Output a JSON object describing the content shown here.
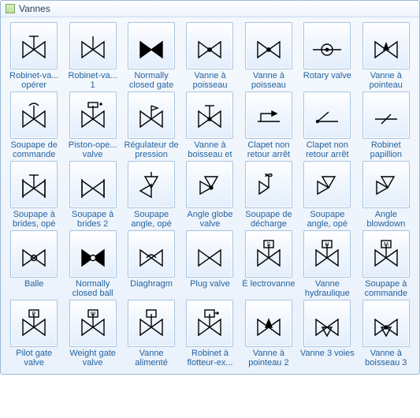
{
  "panel": {
    "title": "Vannes"
  },
  "items": [
    {
      "label": "Robinet-va... opérer",
      "icon": "bowtie-stem-t"
    },
    {
      "label": "Robinet-va... 1",
      "icon": "bowtie-stem"
    },
    {
      "label": "Normally closed gate",
      "icon": "bowtie-solid"
    },
    {
      "label": "Vanne à poisseau",
      "icon": "bowtie-dot"
    },
    {
      "label": "Vanne à poisseau",
      "icon": "bowtie-dot"
    },
    {
      "label": "Rotary valve",
      "icon": "rotary"
    },
    {
      "label": "Vanne à pointeau",
      "icon": "bowtie-needle"
    },
    {
      "label": "Soupape de commande",
      "icon": "bowtie-actuator"
    },
    {
      "label": "Piston-ope... valve",
      "icon": "bowtie-piston"
    },
    {
      "label": "Régulateur de pression",
      "icon": "bowtie-flag"
    },
    {
      "label": "Vanne à boisseau et",
      "icon": "bowtie-dot-stem"
    },
    {
      "label": "Clapet non retour arrêt",
      "icon": "check-arrow"
    },
    {
      "label": "Clapet non retour arrêt",
      "icon": "check-swing"
    },
    {
      "label": "Robinet papillion",
      "icon": "butterfly"
    },
    {
      "label": "Soupape à brides, opé",
      "icon": "bowtie-flanged-stem"
    },
    {
      "label": "Soupape à brides 2",
      "icon": "bowtie-flanged"
    },
    {
      "label": "Soupape angle, opé",
      "icon": "angle-stem"
    },
    {
      "label": "Angle globe valve",
      "icon": "angle-dot"
    },
    {
      "label": "Soupape de décharge",
      "icon": "relief"
    },
    {
      "label": "Soupape angle, opé",
      "icon": "angle-plain"
    },
    {
      "label": "Angle blowdown",
      "icon": "angle-plain"
    },
    {
      "label": "Balle",
      "icon": "bowtie-ball"
    },
    {
      "label": "Normally closed ball",
      "icon": "bowtie-ball-solid"
    },
    {
      "label": "Diaghragm",
      "icon": "bowtie-dome"
    },
    {
      "label": "Plug valve",
      "icon": "bowtie-plain"
    },
    {
      "label": "É lectrovanne",
      "icon": "bowtie-box-s"
    },
    {
      "label": "Vanne hydraulique",
      "icon": "bowtie-box-h"
    },
    {
      "label": "Soupape à commande",
      "icon": "bowtie-box-m"
    },
    {
      "label": "Pilot gate valve",
      "icon": "bowtie-box-p"
    },
    {
      "label": "Weight gate valve",
      "icon": "bowtie-box-w"
    },
    {
      "label": "Vanne alimenté",
      "icon": "bowtie-box"
    },
    {
      "label": "Robinet à flotteur-ex...",
      "icon": "bowtie-float"
    },
    {
      "label": "Vanne à pointeau 2",
      "icon": "bowtie-needle2"
    },
    {
      "label": "Vanne 3 voies",
      "icon": "three-way"
    },
    {
      "label": "Vanne à boisseau 3",
      "icon": "three-way-dot"
    }
  ]
}
